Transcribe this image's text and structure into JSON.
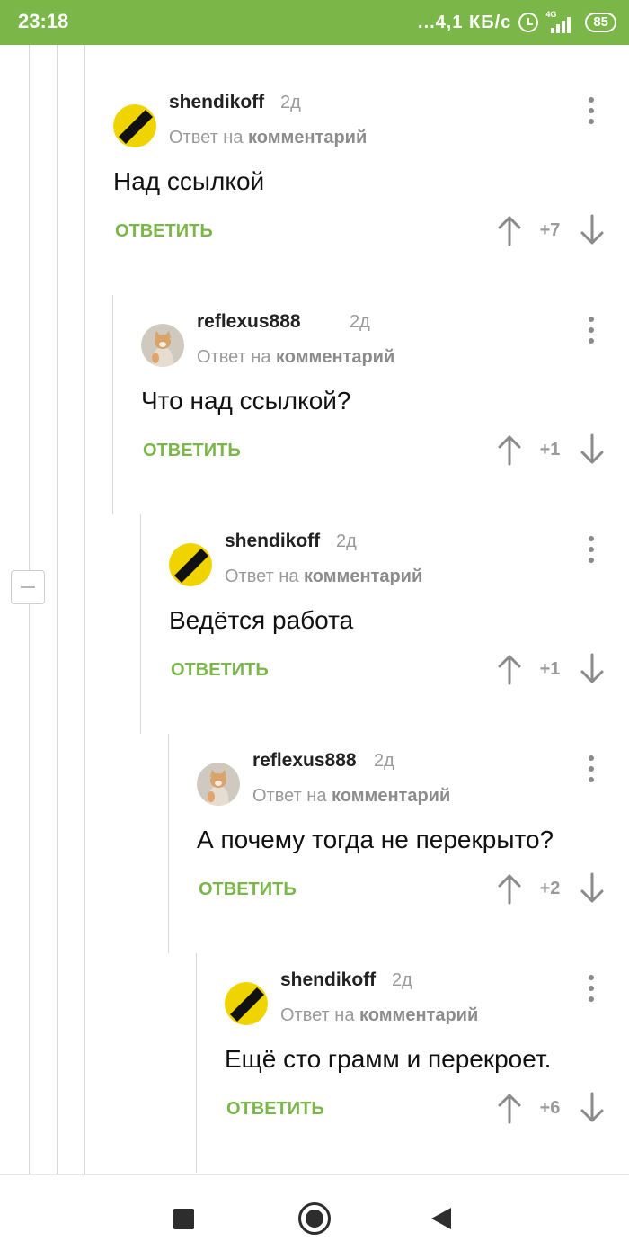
{
  "status_bar": {
    "time": "23:18",
    "network_speed": "...4,1 КБ/с",
    "network_type": "4G",
    "battery": "85",
    "icons": [
      "alarm-icon",
      "signal-icon",
      "battery-icon"
    ]
  },
  "colors": {
    "accent": "#7ab648",
    "muted_text": "#9a9a9a",
    "body_text": "#111111"
  },
  "comments": [
    {
      "author": "shendikoff",
      "time": "2д",
      "reply_prefix": "Ответ на",
      "reply_target": "комментарий",
      "text": "Над ссылкой",
      "reply_label": "ОТВЕТИТЬ",
      "score": "+7",
      "avatar": "yellow-black-stripe-avatar"
    },
    {
      "author": "reflexus888",
      "time": "2д",
      "reply_prefix": "Ответ на",
      "reply_target": "комментарий",
      "text": "Что над ссылкой?",
      "reply_label": "ОТВЕТИТЬ",
      "score": "+1",
      "avatar": "cat-photo-avatar"
    },
    {
      "author": "shendikoff",
      "time": "2д",
      "reply_prefix": "Ответ на",
      "reply_target": "комментарий",
      "text": "Ведётся работа",
      "reply_label": "ОТВЕТИТЬ",
      "score": "+1",
      "avatar": "yellow-black-stripe-avatar"
    },
    {
      "author": "reflexus888",
      "time": "2д",
      "reply_prefix": "Ответ на",
      "reply_target": "комментарий",
      "text": "А почему тогда не перекрыто?",
      "reply_label": "ОТВЕТИТЬ",
      "score": "+2",
      "avatar": "cat-photo-avatar"
    },
    {
      "author": "shendikoff",
      "time": "2д",
      "reply_prefix": "Ответ на",
      "reply_target": "комментарий",
      "text": "Ещё сто грамм и перекроет.",
      "reply_label": "ОТВЕТИТЬ",
      "score": "+6",
      "avatar": "yellow-black-stripe-avatar"
    }
  ],
  "nav_bar": {
    "icons": [
      "recents-square-icon",
      "home-circle-icon",
      "back-triangle-icon"
    ]
  }
}
